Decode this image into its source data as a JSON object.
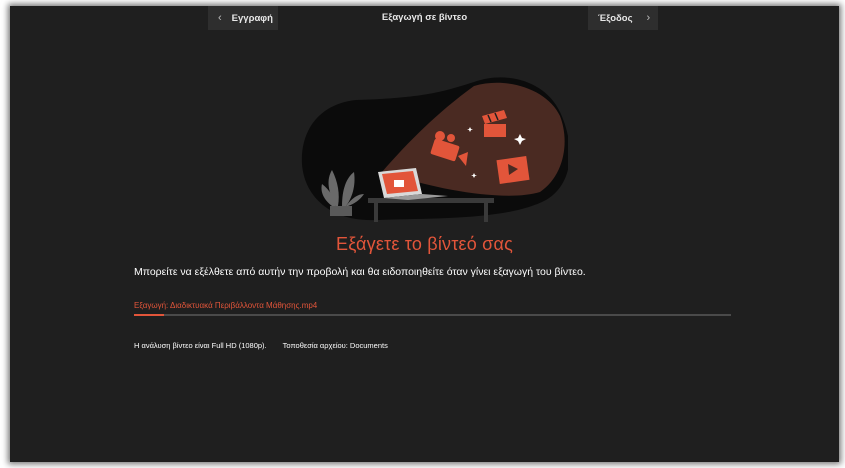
{
  "header": {
    "back_label": "Εγγραφή",
    "title": "Εξαγωγή σε βίντεο",
    "exit_label": "Έξοδος"
  },
  "main": {
    "heading": "Εξάγετε το βίντεό σας",
    "subtitle": "Μπορείτε να εξέλθετε από αυτήν την προβολή και θα ειδοποιηθείτε όταν γίνει εξαγωγή του βίντεο.",
    "export_label": "Εξαγωγή: Διαδικτυακά Περιβάλλοντα Μάθησης.mp4",
    "progress_percent": 5,
    "resolution_text": "Η ανάλυση βίντεο είναι Full HD (1080p).",
    "location_text": "Τοποθεσία αρχείου: Documents"
  },
  "icons": {
    "back": "chevron-left-icon",
    "exit": "chevron-right-icon"
  },
  "colors": {
    "accent": "#e2553a",
    "background": "#1f1f1f",
    "button": "#2e2e2e"
  }
}
